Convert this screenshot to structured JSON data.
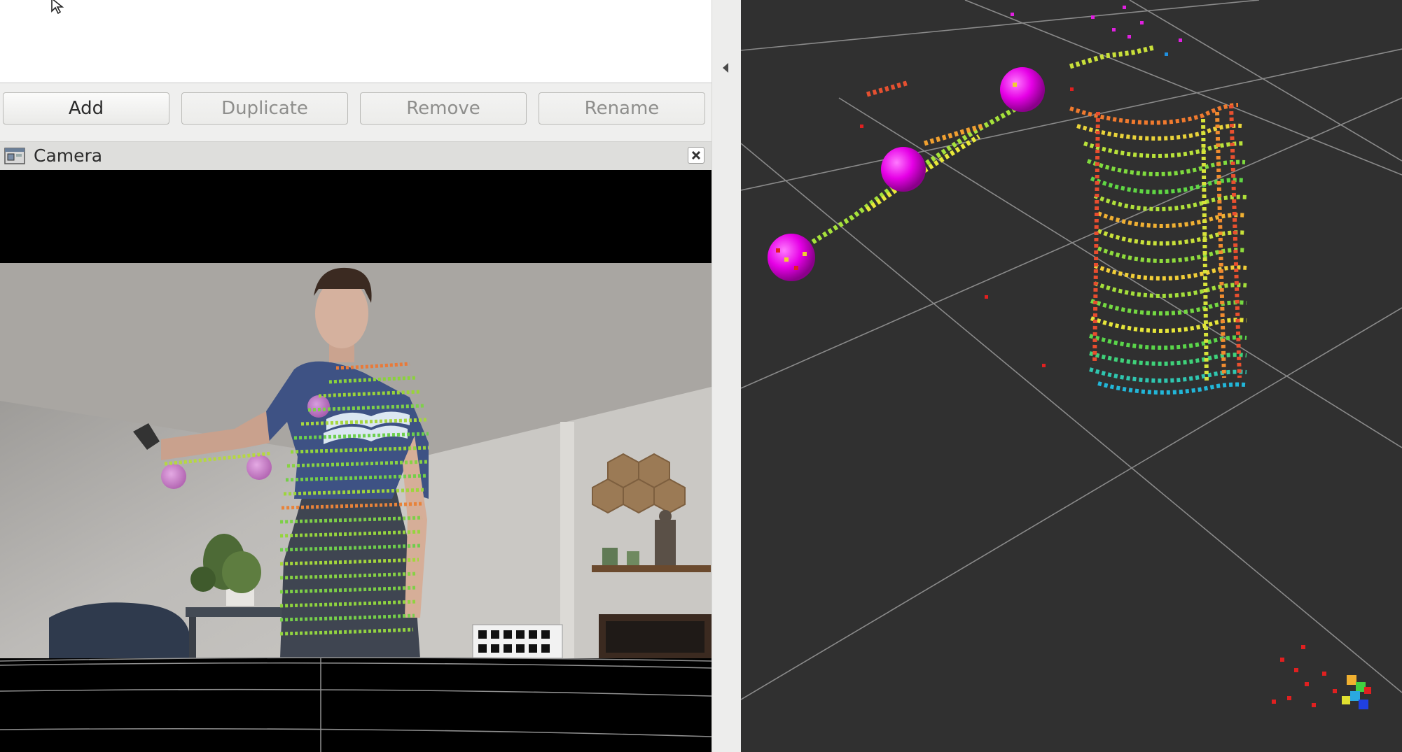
{
  "views_panel": {
    "buttons": {
      "add": "Add",
      "duplicate": "Duplicate",
      "remove": "Remove",
      "rename": "Rename"
    }
  },
  "camera_panel": {
    "title": "Camera",
    "icons": {
      "panel": "camera-panel-icon",
      "close": "close-icon"
    }
  },
  "render_view": {
    "background": "#303030",
    "grid_color": "#8a8a8a",
    "marker_color": "#ff00ff"
  },
  "splitter": {
    "icon": "collapse-left-icon"
  }
}
